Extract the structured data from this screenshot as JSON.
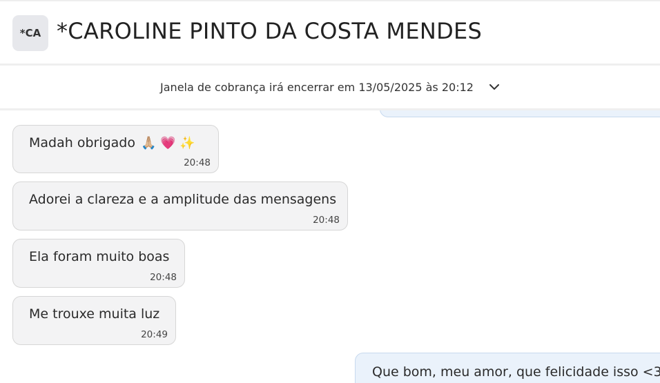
{
  "header": {
    "avatar_initials": "*CA",
    "contact_name": "*CAROLINE PINTO DA COSTA MENDES"
  },
  "billing": {
    "text": "Janela de cobrança irá encerrar em 13/05/2025 às 20:12"
  },
  "messages": [
    {
      "direction": "in",
      "text": "Madah obrigado",
      "emojis": "🙏🏼 💗 ✨",
      "time": "20:48"
    },
    {
      "direction": "in",
      "text": "Adorei a clareza e a amplitude das mensagens",
      "time": "20:48"
    },
    {
      "direction": "in",
      "text": "Ela foram muito boas",
      "time": "20:48"
    },
    {
      "direction": "in",
      "text": "Me trouxe muita luz",
      "time": "20:49"
    },
    {
      "direction": "out",
      "text": "Que bom, meu amor, que felicidade isso <3."
    }
  ],
  "colors": {
    "incoming_bubble": "#f3f3f4",
    "outgoing_bubble": "#eaf2fb",
    "outgoing_border": "#c7d9ee"
  }
}
